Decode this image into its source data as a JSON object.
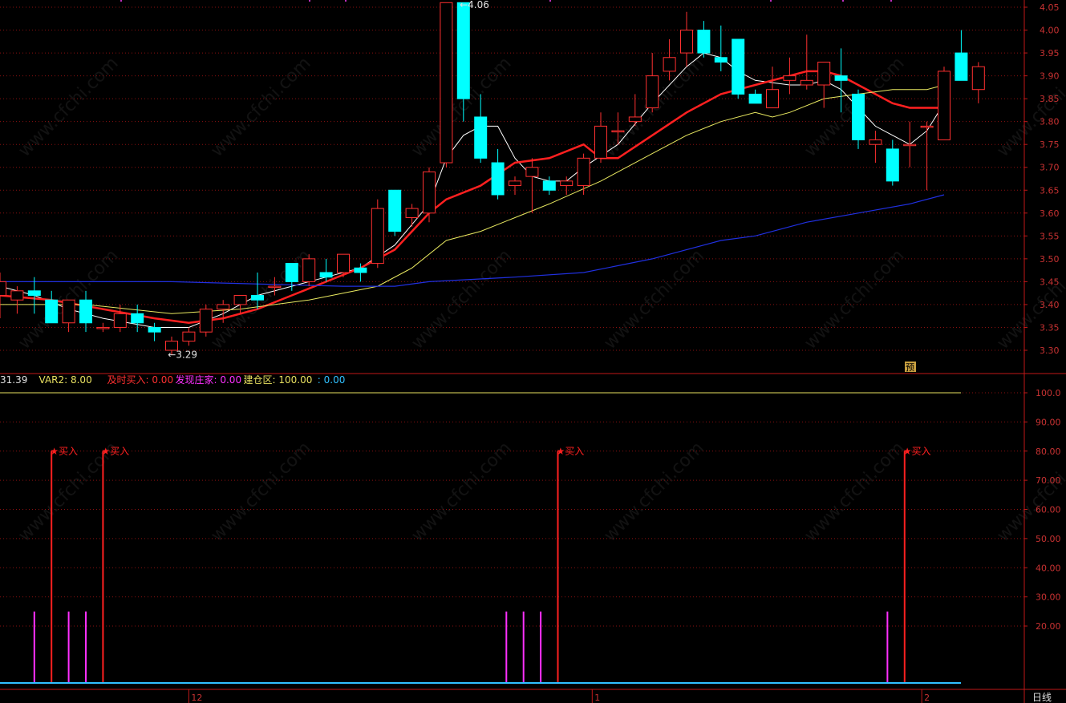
{
  "chart_data": [
    {
      "type": "candlestick",
      "y_range": [
        3.26,
        4.06
      ],
      "y_ticks": [
        "4.05",
        "4.00",
        "3.95",
        "3.90",
        "3.85",
        "3.80",
        "3.75",
        "3.70",
        "3.65",
        "3.60",
        "3.55",
        "3.50",
        "3.45",
        "3.40",
        "3.35",
        "3.30"
      ],
      "candles": [
        {
          "o": 3.42,
          "h": 3.47,
          "l": 3.37,
          "c": 3.45
        },
        {
          "o": 3.41,
          "h": 3.44,
          "l": 3.38,
          "c": 3.43
        },
        {
          "o": 3.43,
          "h": 3.46,
          "l": 3.38,
          "c": 3.42
        },
        {
          "o": 3.41,
          "h": 3.43,
          "l": 3.36,
          "c": 3.36
        },
        {
          "o": 3.36,
          "h": 3.41,
          "l": 3.34,
          "c": 3.41
        },
        {
          "o": 3.41,
          "h": 3.43,
          "l": 3.34,
          "c": 3.36
        },
        {
          "o": 3.35,
          "h": 3.36,
          "l": 3.34,
          "c": 3.35
        },
        {
          "o": 3.35,
          "h": 3.4,
          "l": 3.34,
          "c": 3.38
        },
        {
          "o": 3.38,
          "h": 3.4,
          "l": 3.34,
          "c": 3.36
        },
        {
          "o": 3.35,
          "h": 3.36,
          "l": 3.32,
          "c": 3.34
        },
        {
          "o": 3.3,
          "h": 3.33,
          "l": 3.29,
          "c": 3.32
        },
        {
          "o": 3.32,
          "h": 3.35,
          "l": 3.31,
          "c": 3.34
        },
        {
          "o": 3.34,
          "h": 3.4,
          "l": 3.33,
          "c": 3.39
        },
        {
          "o": 3.39,
          "h": 3.41,
          "l": 3.36,
          "c": 3.4
        },
        {
          "o": 3.4,
          "h": 3.42,
          "l": 3.38,
          "c": 3.42
        },
        {
          "o": 3.42,
          "h": 3.47,
          "l": 3.39,
          "c": 3.41
        },
        {
          "o": 3.44,
          "h": 3.46,
          "l": 3.42,
          "c": 3.44
        },
        {
          "o": 3.49,
          "h": 3.49,
          "l": 3.43,
          "c": 3.45
        },
        {
          "o": 3.45,
          "h": 3.51,
          "l": 3.44,
          "c": 3.5
        },
        {
          "o": 3.47,
          "h": 3.5,
          "l": 3.45,
          "c": 3.46
        },
        {
          "o": 3.47,
          "h": 3.51,
          "l": 3.46,
          "c": 3.51
        },
        {
          "o": 3.48,
          "h": 3.49,
          "l": 3.45,
          "c": 3.47
        },
        {
          "o": 3.49,
          "h": 3.63,
          "l": 3.48,
          "c": 3.61
        },
        {
          "o": 3.65,
          "h": 3.65,
          "l": 3.55,
          "c": 3.56
        },
        {
          "o": 3.59,
          "h": 3.62,
          "l": 3.57,
          "c": 3.61
        },
        {
          "o": 3.6,
          "h": 3.7,
          "l": 3.58,
          "c": 3.69
        },
        {
          "o": 3.71,
          "h": 4.06,
          "l": 3.7,
          "c": 4.06
        },
        {
          "o": 4.06,
          "h": 4.06,
          "l": 3.8,
          "c": 3.85
        },
        {
          "o": 3.81,
          "h": 3.86,
          "l": 3.71,
          "c": 3.72
        },
        {
          "o": 3.71,
          "h": 3.74,
          "l": 3.63,
          "c": 3.64
        },
        {
          "o": 3.66,
          "h": 3.68,
          "l": 3.64,
          "c": 3.67
        },
        {
          "o": 3.68,
          "h": 3.72,
          "l": 3.6,
          "c": 3.7
        },
        {
          "o": 3.67,
          "h": 3.68,
          "l": 3.64,
          "c": 3.65
        },
        {
          "o": 3.66,
          "h": 3.68,
          "l": 3.64,
          "c": 3.67
        },
        {
          "o": 3.66,
          "h": 3.73,
          "l": 3.64,
          "c": 3.72
        },
        {
          "o": 3.72,
          "h": 3.82,
          "l": 3.71,
          "c": 3.79
        },
        {
          "o": 3.78,
          "h": 3.82,
          "l": 3.75,
          "c": 3.78
        },
        {
          "o": 3.8,
          "h": 3.86,
          "l": 3.79,
          "c": 3.81
        },
        {
          "o": 3.83,
          "h": 3.95,
          "l": 3.82,
          "c": 3.9
        },
        {
          "o": 3.91,
          "h": 3.98,
          "l": 3.89,
          "c": 3.94
        },
        {
          "o": 3.95,
          "h": 4.04,
          "l": 3.92,
          "c": 4.0
        },
        {
          "o": 4.0,
          "h": 4.02,
          "l": 3.94,
          "c": 3.95
        },
        {
          "o": 3.94,
          "h": 4.01,
          "l": 3.91,
          "c": 3.93
        },
        {
          "o": 3.98,
          "h": 3.98,
          "l": 3.85,
          "c": 3.86
        },
        {
          "o": 3.86,
          "h": 3.87,
          "l": 3.84,
          "c": 3.84
        },
        {
          "o": 3.83,
          "h": 3.92,
          "l": 3.83,
          "c": 3.87
        },
        {
          "o": 3.89,
          "h": 3.94,
          "l": 3.86,
          "c": 3.9
        },
        {
          "o": 3.88,
          "h": 3.99,
          "l": 3.87,
          "c": 3.89
        },
        {
          "o": 3.88,
          "h": 3.92,
          "l": 3.83,
          "c": 3.93
        },
        {
          "o": 3.9,
          "h": 3.96,
          "l": 3.82,
          "c": 3.89
        },
        {
          "o": 3.86,
          "h": 3.87,
          "l": 3.74,
          "c": 3.76
        },
        {
          "o": 3.75,
          "h": 3.78,
          "l": 3.71,
          "c": 3.76
        },
        {
          "o": 3.74,
          "h": 3.76,
          "l": 3.66,
          "c": 3.67
        },
        {
          "o": 3.75,
          "h": 3.8,
          "l": 3.7,
          "c": 3.75
        },
        {
          "o": 3.79,
          "h": 3.8,
          "l": 3.65,
          "c": 3.79
        },
        {
          "o": 3.76,
          "h": 3.92,
          "l": 3.76,
          "c": 3.91
        },
        {
          "o": 3.95,
          "h": 4.0,
          "l": 3.89,
          "c": 3.89
        },
        {
          "o": 3.87,
          "h": 3.93,
          "l": 3.84,
          "c": 3.92
        }
      ],
      "ma_lines": [
        {
          "name": "MA5",
          "color": "#ffffff",
          "width": 1,
          "points": [
            [
              0,
              3.44
            ],
            [
              2,
              3.42
            ],
            [
              4,
              3.39
            ],
            [
              6,
              3.37
            ],
            [
              9,
              3.35
            ],
            [
              11,
              3.35
            ],
            [
              13,
              3.38
            ],
            [
              15,
              3.42
            ],
            [
              17,
              3.44
            ],
            [
              19,
              3.46
            ],
            [
              21,
              3.48
            ],
            [
              23,
              3.53
            ],
            [
              25,
              3.62
            ],
            [
              26,
              3.72
            ],
            [
              27,
              3.77
            ],
            [
              28,
              3.79
            ],
            [
              29,
              3.79
            ],
            [
              30,
              3.72
            ],
            [
              31,
              3.68
            ],
            [
              32,
              3.67
            ],
            [
              33,
              3.67
            ],
            [
              34,
              3.7
            ],
            [
              36,
              3.75
            ],
            [
              38,
              3.84
            ],
            [
              40,
              3.92
            ],
            [
              41,
              3.95
            ],
            [
              42,
              3.94
            ],
            [
              43,
              3.91
            ],
            [
              44,
              3.89
            ],
            [
              46,
              3.88
            ],
            [
              47,
              3.88
            ],
            [
              48,
              3.89
            ],
            [
              49,
              3.87
            ],
            [
              50,
              3.83
            ],
            [
              51,
              3.79
            ],
            [
              52,
              3.77
            ],
            [
              53,
              3.75
            ],
            [
              54,
              3.78
            ],
            [
              55,
              3.84
            ]
          ]
        },
        {
          "name": "MA10",
          "color": "#ff2020",
          "width": 2.5,
          "points": [
            [
              0,
              3.42
            ],
            [
              3,
              3.41
            ],
            [
              6,
              3.39
            ],
            [
              9,
              3.37
            ],
            [
              11,
              3.36
            ],
            [
              13,
              3.37
            ],
            [
              15,
              3.39
            ],
            [
              17,
              3.42
            ],
            [
              19,
              3.45
            ],
            [
              21,
              3.48
            ],
            [
              23,
              3.52
            ],
            [
              25,
              3.6
            ],
            [
              26,
              3.63
            ],
            [
              28,
              3.66
            ],
            [
              30,
              3.71
            ],
            [
              32,
              3.72
            ],
            [
              34,
              3.75
            ],
            [
              35,
              3.72
            ],
            [
              36,
              3.72
            ],
            [
              38,
              3.77
            ],
            [
              40,
              3.82
            ],
            [
              42,
              3.86
            ],
            [
              44,
              3.88
            ],
            [
              46,
              3.9
            ],
            [
              47,
              3.91
            ],
            [
              48,
              3.91
            ],
            [
              49,
              3.9
            ],
            [
              50,
              3.88
            ],
            [
              51,
              3.86
            ],
            [
              52,
              3.84
            ],
            [
              53,
              3.83
            ],
            [
              54,
              3.83
            ],
            [
              55,
              3.83
            ]
          ]
        },
        {
          "name": "MA20",
          "color": "#e8e860",
          "width": 1,
          "points": [
            [
              0,
              3.4
            ],
            [
              5,
              3.4
            ],
            [
              10,
              3.38
            ],
            [
              14,
              3.39
            ],
            [
              18,
              3.41
            ],
            [
              22,
              3.44
            ],
            [
              24,
              3.48
            ],
            [
              26,
              3.54
            ],
            [
              28,
              3.56
            ],
            [
              30,
              3.59
            ],
            [
              32,
              3.62
            ],
            [
              35,
              3.67
            ],
            [
              38,
              3.73
            ],
            [
              40,
              3.77
            ],
            [
              42,
              3.8
            ],
            [
              44,
              3.82
            ],
            [
              45,
              3.81
            ],
            [
              46,
              3.82
            ],
            [
              48,
              3.85
            ],
            [
              50,
              3.86
            ],
            [
              52,
              3.87
            ],
            [
              54,
              3.87
            ],
            [
              55,
              3.88
            ]
          ]
        },
        {
          "name": "MA60",
          "color": "#2030e0",
          "width": 1.2,
          "points": [
            [
              0,
              3.45
            ],
            [
              10,
              3.45
            ],
            [
              20,
              3.44
            ],
            [
              23,
              3.44
            ],
            [
              25,
              3.45
            ],
            [
              30,
              3.46
            ],
            [
              34,
              3.47
            ],
            [
              38,
              3.5
            ],
            [
              42,
              3.54
            ],
            [
              44,
              3.55
            ],
            [
              47,
              3.58
            ],
            [
              50,
              3.6
            ],
            [
              53,
              3.62
            ],
            [
              55,
              3.64
            ]
          ]
        }
      ],
      "annotations": [
        {
          "text": "4.06",
          "idx": 26.5,
          "y": 4.055
        },
        {
          "text": "3.29",
          "idx": 9.5,
          "y": 3.29
        }
      ],
      "marker_label": "预"
    },
    {
      "type": "indicator",
      "legend": [
        {
          "text": "31.39",
          "color": "#e0e0e0"
        },
        {
          "text": "VAR2: 8.00",
          "color": "#e8e060"
        },
        {
          "text": "及时买入: 0.00",
          "color": "#ff3030"
        },
        {
          "text": "发现庄家: 0.00",
          "color": "#ff30ff"
        },
        {
          "text": "建仓区: 100.00",
          "color": "#e8e060"
        },
        {
          "text": ": 0.00",
          "color": "#30c0ff"
        }
      ],
      "y_range": [
        0,
        110
      ],
      "y_ticks": [
        "100.0",
        "90.00",
        "80.00",
        "70.00",
        "60.00",
        "50.00",
        "40.00",
        "30.00",
        "20.00"
      ],
      "jiancang_level": 100,
      "buy_signals": [
        {
          "idx": 3,
          "value": 80,
          "label": "★买入"
        },
        {
          "idx": 6,
          "value": 80,
          "label": "★买入"
        },
        {
          "idx": 32.5,
          "value": 80,
          "label": "★买入"
        },
        {
          "idx": 52.7,
          "value": 80,
          "label": "★买入"
        }
      ],
      "banker_signals": [
        {
          "idx": 2,
          "value": 25
        },
        {
          "idx": 4,
          "value": 25
        },
        {
          "idx": 5,
          "value": 25
        },
        {
          "idx": 29.5,
          "value": 25
        },
        {
          "idx": 30.5,
          "value": 25
        },
        {
          "idx": 31.5,
          "value": 25
        },
        {
          "idx": 51.7,
          "value": 25
        }
      ]
    }
  ],
  "x_axis": {
    "labels": [
      {
        "text": "12",
        "idx": 11
      },
      {
        "text": "1",
        "idx": 34.5
      },
      {
        "text": "2",
        "idx": 53.7
      }
    ]
  },
  "period_label": "日线",
  "watermark": "www.cfchi.com",
  "colors": {
    "up": "#ff3030",
    "down": "#00ffff",
    "grid": "#8a1010",
    "frame": "#c01818",
    "axis_text": "#c83232"
  }
}
